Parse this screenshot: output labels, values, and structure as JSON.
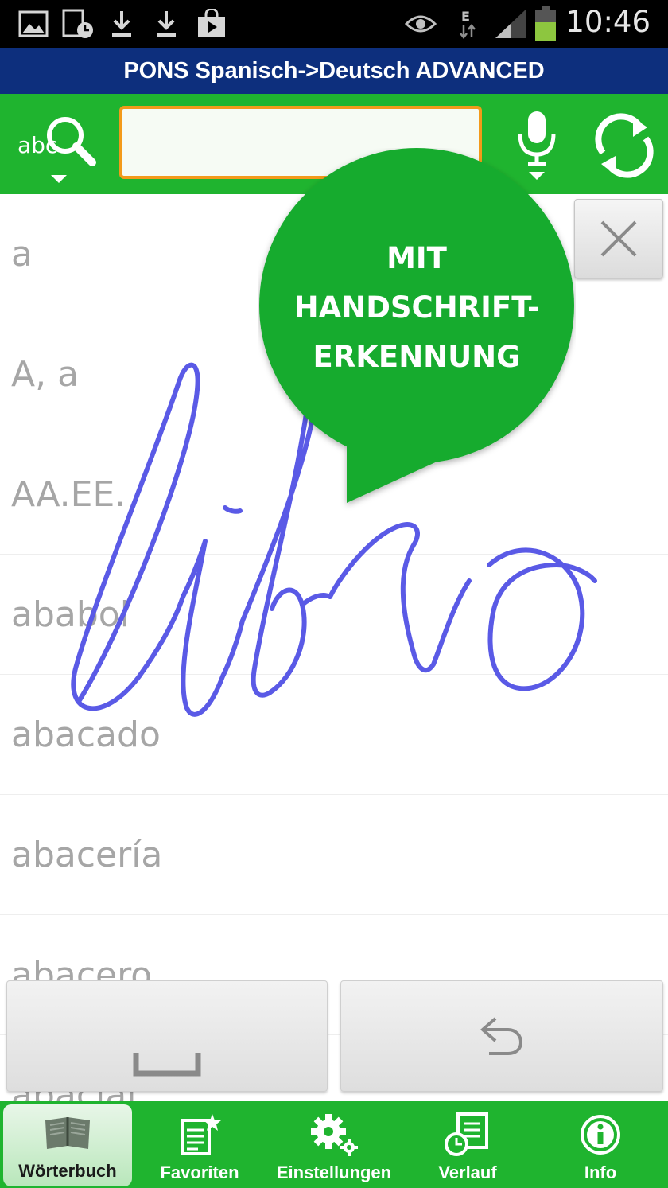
{
  "status_bar": {
    "time": "10:46",
    "icons": [
      "gallery-icon",
      "calendar-sync-icon",
      "download-icon",
      "download-icon",
      "play-store-icon",
      "eye-icon",
      "data-e-icon",
      "signal-icon",
      "battery-icon"
    ]
  },
  "app": {
    "title": "PONS Spanisch->Deutsch ADVANCED"
  },
  "search": {
    "placeholder": "",
    "value": "",
    "mode_label": "abc"
  },
  "word_list": [
    "a",
    "A, a",
    "AA.EE.",
    "ababol",
    "abacado",
    "abacería",
    "abacero",
    "abacial"
  ],
  "overlay": {
    "bubble_lines": [
      "MIT",
      "HANDSCHRIFT-",
      "ERKENNUNG"
    ],
    "handwritten_word": "libro"
  },
  "keyboard": {
    "space_icon": "space-icon",
    "undo_icon": "undo-icon"
  },
  "bottom_nav": [
    {
      "label": "Wörterbuch",
      "icon": "book-icon",
      "active": true
    },
    {
      "label": "Favoriten",
      "icon": "favorites-icon",
      "active": false
    },
    {
      "label": "Einstellungen",
      "icon": "settings-icon",
      "active": false
    },
    {
      "label": "Verlauf",
      "icon": "history-icon",
      "active": false
    },
    {
      "label": "Info",
      "icon": "info-icon",
      "active": false
    }
  ],
  "colors": {
    "toolbar_green": "#1fb42f",
    "title_blue": "#0d2f7d",
    "input_border": "#f39a1a",
    "ink_blue": "#5a5ae6",
    "bubble_green": "#16ab2e"
  }
}
